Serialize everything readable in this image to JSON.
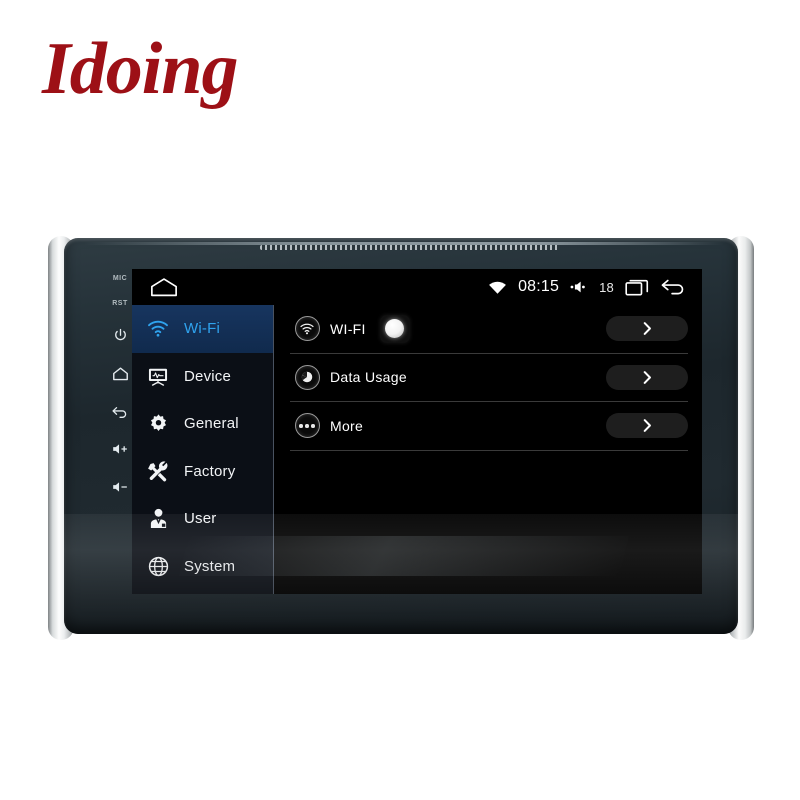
{
  "brand": {
    "logo_text": "Idoing"
  },
  "device": {
    "side_buttons": [
      {
        "name": "mic-label",
        "label": "MIC",
        "type": "text"
      },
      {
        "name": "reset-label",
        "label": "RST",
        "type": "text"
      },
      {
        "name": "power-button",
        "label": "power",
        "type": "icon"
      },
      {
        "name": "home-button",
        "label": "home",
        "type": "icon"
      },
      {
        "name": "back-button",
        "label": "back",
        "type": "icon"
      },
      {
        "name": "volume-up-button",
        "label": "volume-up",
        "type": "icon"
      },
      {
        "name": "volume-down-button",
        "label": "volume-down",
        "type": "icon"
      }
    ]
  },
  "statusbar": {
    "home_icon": "home-icon",
    "wifi_icon": "wifi-signal-icon",
    "time": "08:15",
    "volume_icon": "volume-icon",
    "volume_level": "18",
    "recents_icon": "recent-apps-icon",
    "back_icon": "back-arrow-icon"
  },
  "sidebar": {
    "items": [
      {
        "label": "Wi-Fi",
        "icon": "wifi-icon",
        "active": true
      },
      {
        "label": "Device",
        "icon": "device-icon",
        "active": false
      },
      {
        "label": "General",
        "icon": "gear-icon",
        "active": false
      },
      {
        "label": "Factory",
        "icon": "tools-icon",
        "active": false
      },
      {
        "label": "User",
        "icon": "user-icon",
        "active": false
      },
      {
        "label": "System",
        "icon": "globe-icon",
        "active": false
      }
    ]
  },
  "main": {
    "rows": [
      {
        "label": "WI-FI",
        "icon": "wifi-badge-icon",
        "toggle": true,
        "toggle_on": true,
        "chevron": "chevron-right-icon"
      },
      {
        "label": "Data Usage",
        "icon": "data-usage-badge-icon",
        "toggle": false,
        "chevron": "chevron-right-icon"
      },
      {
        "label": "More",
        "icon": "more-badge-icon",
        "toggle": false,
        "chevron": "chevron-right-icon"
      }
    ]
  },
  "colors": {
    "brand_red": "#9d1016",
    "accent_blue": "#2fa3ee",
    "sidebar_active_bg": "#17355f",
    "screen_bg": "#000000",
    "chevron_btn_bg": "#1e1e1e"
  }
}
